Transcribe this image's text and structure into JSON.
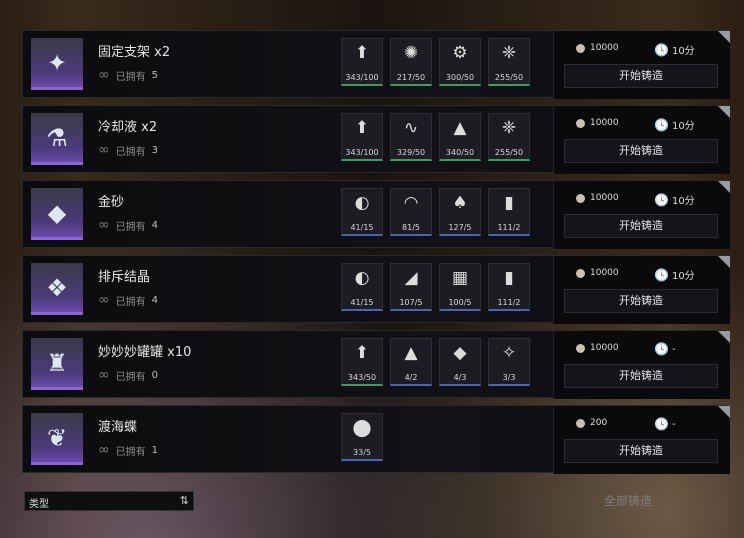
{
  "items": [
    {
      "name": "固定支架 x2",
      "icon": "✦",
      "owned_label": "已拥有",
      "owned_count": "5",
      "materials": [
        {
          "icon": "⬆",
          "qty": "343/100",
          "color": "green"
        },
        {
          "icon": "✺",
          "qty": "217/50",
          "color": "green"
        },
        {
          "icon": "⚙",
          "qty": "300/50",
          "color": "green"
        },
        {
          "icon": "❈",
          "qty": "255/50",
          "color": "green"
        }
      ],
      "cost": "10000",
      "time": "10分",
      "button": "开始铸造"
    },
    {
      "name": "冷却液 x2",
      "icon": "⚗",
      "owned_label": "已拥有",
      "owned_count": "3",
      "materials": [
        {
          "icon": "⬆",
          "qty": "343/100",
          "color": "green"
        },
        {
          "icon": "∿",
          "qty": "329/50",
          "color": "green"
        },
        {
          "icon": "▲",
          "qty": "340/50",
          "color": "green"
        },
        {
          "icon": "❈",
          "qty": "255/50",
          "color": "green"
        }
      ],
      "cost": "10000",
      "time": "10分",
      "button": "开始铸造"
    },
    {
      "name": "金砂",
      "icon": "◆",
      "owned_label": "已拥有",
      "owned_count": "4",
      "materials": [
        {
          "icon": "◐",
          "qty": "41/15",
          "color": "blue"
        },
        {
          "icon": "◠",
          "qty": "81/5",
          "color": "blue"
        },
        {
          "icon": "♠",
          "qty": "127/5",
          "color": "blue"
        },
        {
          "icon": "▮",
          "qty": "111/2",
          "color": "blue"
        }
      ],
      "cost": "10000",
      "time": "10分",
      "button": "开始铸造"
    },
    {
      "name": "排斥结晶",
      "icon": "❖",
      "owned_label": "已拥有",
      "owned_count": "4",
      "materials": [
        {
          "icon": "◐",
          "qty": "41/15",
          "color": "blue"
        },
        {
          "icon": "◢",
          "qty": "107/5",
          "color": "blue"
        },
        {
          "icon": "▦",
          "qty": "100/5",
          "color": "blue"
        },
        {
          "icon": "▮",
          "qty": "111/2",
          "color": "blue"
        }
      ],
      "cost": "10000",
      "time": "10分",
      "button": "开始铸造"
    },
    {
      "name": "妙妙妙罐罐 x10",
      "icon": "♜",
      "owned_label": "已拥有",
      "owned_count": "0",
      "materials": [
        {
          "icon": "⬆",
          "qty": "343/50",
          "color": "green"
        },
        {
          "icon": "▲",
          "qty": "4/2",
          "color": "blue"
        },
        {
          "icon": "◆",
          "qty": "4/3",
          "color": "blue"
        },
        {
          "icon": "✧",
          "qty": "3/3",
          "color": "blue"
        }
      ],
      "cost": "10000",
      "time": "-",
      "button": "开始铸造"
    },
    {
      "name": "渡海蝶",
      "icon": "❦",
      "owned_label": "已拥有",
      "owned_count": "1",
      "materials": [
        {
          "icon": "⬤",
          "qty": "33/5",
          "color": "blue"
        }
      ],
      "cost": "200",
      "time": "-",
      "button": "开始铸造"
    }
  ],
  "footer": {
    "type_label": "类型",
    "sort_icon": "⇅",
    "all_button": "全部铸造"
  }
}
